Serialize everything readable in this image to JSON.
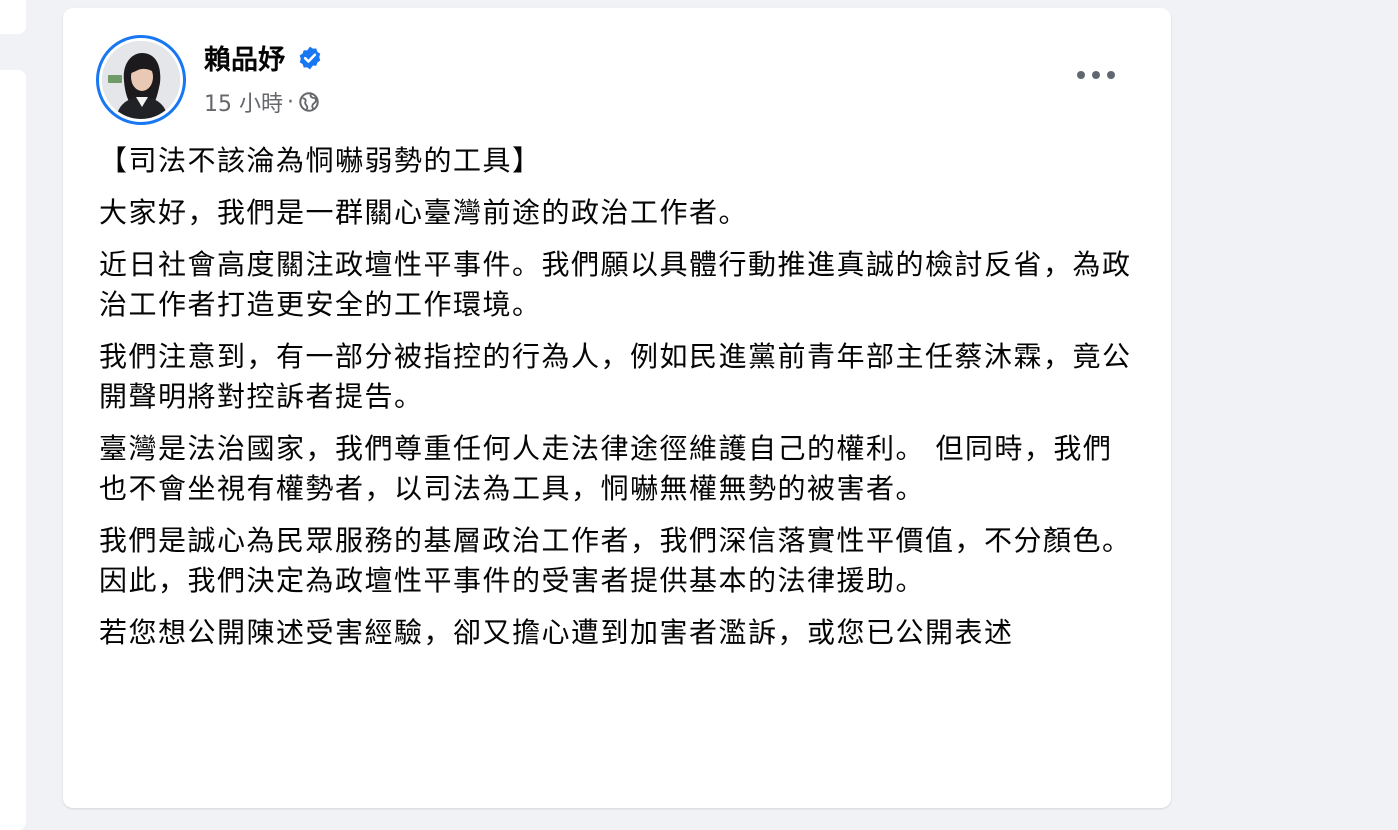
{
  "post": {
    "author": "賴品妤",
    "time": "15 小時",
    "separator": "·",
    "title": "【司法不該淪為恫嚇弱勢的工具】",
    "paragraphs": [
      "大家好，我們是一群關心臺灣前途的政治工作者。",
      "近日社會高度關注政壇性平事件。我們願以具體行動推進真誠的檢討反省，為政治工作者打造更安全的工作環境。",
      "我們注意到，有一部分被指控的行為人，例如民進黨前青年部主任蔡沐霖，竟公開聲明將對控訴者提告。",
      "臺灣是法治國家，我們尊重任何人走法律途徑維護自己的權利。 但同時，我們也不會坐視有權勢者，以司法為工具，恫嚇無權無勢的被害者。",
      "我們是誠心為民眾服務的基層政治工作者，我們深信落實性平價值，不分顏色。 因此，我們決定為政壇性平事件的受害者提供基本的法律援助。",
      "若您想公開陳述受害經驗，卻又擔心遭到加害者濫訴，或您已公開表述"
    ],
    "icons": {
      "verified": "verified-badge-icon",
      "audience": "globe-icon",
      "more": "more-options-icon"
    }
  },
  "colors": {
    "accent": "#1877f2",
    "text": "#050505",
    "secondary": "#65676b",
    "background": "#f0f2f5"
  }
}
